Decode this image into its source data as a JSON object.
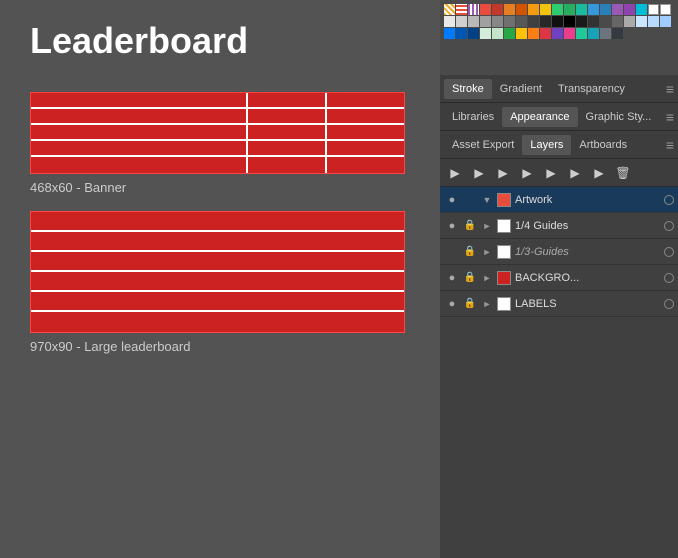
{
  "left": {
    "title": "Leaderboard",
    "banner_small_label": "468x60 - Banner",
    "banner_large_label": "970x90 - Large leaderboard"
  },
  "right": {
    "swatches": {
      "colors": [
        "#f5a623",
        "#e74c3c",
        "#e67e22",
        "#2ecc71",
        "#3498db",
        "#9b59b6",
        "#1abc9c",
        "#e91e63",
        "#ffffff",
        "#dddddd",
        "#bbbbbb",
        "#999999",
        "#777777",
        "#555555",
        "#333333",
        "#111111",
        "#ff0000",
        "#ff6600",
        "#ffcc00",
        "#00ff00",
        "#00ccff",
        "#0000ff",
        "#cc00ff",
        "#ff00cc",
        "#ffffff",
        "#f0f0f0",
        "#d0d0d0",
        "#b0b0b0",
        "#909090",
        "#707070",
        "#505050",
        "#303030",
        "#f8d7da",
        "#f5c6cb",
        "#f1b0b7",
        "#ec868e",
        "#e35d6a",
        "#dc3545",
        "#c82333",
        "#bd2130",
        "#ccddee",
        "#bbccdd",
        "#aabbcc",
        "#99aabb",
        "#8899aa",
        "#778899",
        "#667788",
        "#556677",
        "#ffeeba",
        "#ffd060"
      ]
    },
    "tab_row1": {
      "tabs": [
        "Stroke",
        "Gradient",
        "Transparency"
      ],
      "active": "Stroke"
    },
    "tab_row2": {
      "tabs": [
        "Libraries",
        "Appearance",
        "Graphic Sty..."
      ],
      "active": "Appearance"
    },
    "tab_row3": {
      "tabs": [
        "Asset Export",
        "Layers",
        "Artboards"
      ],
      "active": "Layers"
    },
    "toolbar": {
      "icons": [
        "visibility",
        "settings",
        "layers",
        "artboard",
        "grid",
        "folder",
        "link",
        "trash"
      ]
    },
    "layers": [
      {
        "id": "artwork",
        "name": "Artwork",
        "visible": true,
        "locked": false,
        "expanded": true,
        "color": "#ffffff",
        "selected": true
      },
      {
        "id": "guides-14",
        "name": "1/4 Guides",
        "visible": true,
        "locked": true,
        "expanded": false,
        "color": "#ffffff",
        "selected": false
      },
      {
        "id": "guides-13",
        "name": "1/3-Guides",
        "visible": false,
        "locked": true,
        "expanded": false,
        "color": "#ffffff",
        "italic": true,
        "selected": false
      },
      {
        "id": "background",
        "name": "BACKGRO...",
        "visible": true,
        "locked": true,
        "expanded": false,
        "color": "#cc2222",
        "selected": false
      },
      {
        "id": "labels",
        "name": "LABELS",
        "visible": true,
        "locked": true,
        "expanded": false,
        "color": "#ffffff",
        "selected": false
      }
    ]
  }
}
